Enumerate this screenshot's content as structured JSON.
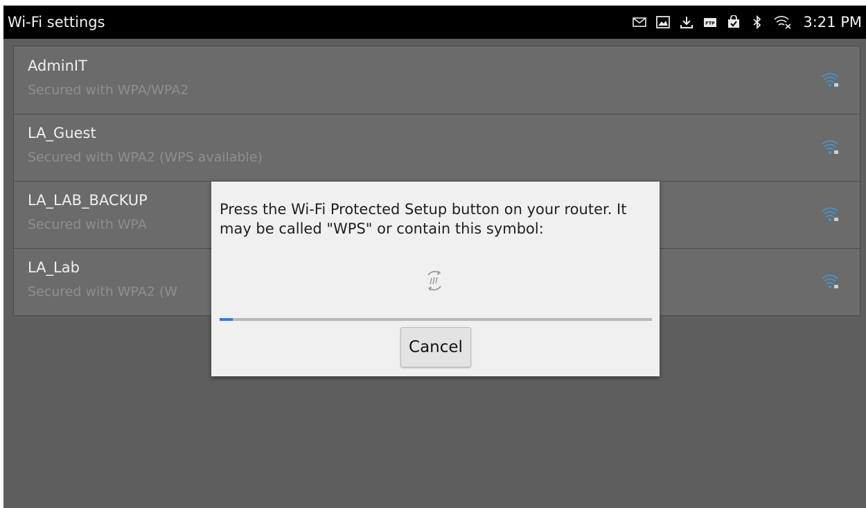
{
  "statusbar": {
    "title": "Wi-Fi settings",
    "time": "3:21 PM",
    "icons": [
      "mail-icon",
      "image-icon",
      "download-icon",
      "ftp-icon",
      "bag-check-icon",
      "bluetooth-icon",
      "wifi-x-icon"
    ]
  },
  "networks": [
    {
      "ssid": "AdminIT",
      "security": "Secured with WPA/WPA2"
    },
    {
      "ssid": "LA_Guest",
      "security": "Secured with WPA2 (WPS available)"
    },
    {
      "ssid": "LA_LAB_BACKUP",
      "security": "Secured with WPA"
    },
    {
      "ssid": "LA_Lab",
      "security": "Secured with WPA2 (W"
    }
  ],
  "dialog": {
    "message": "Press the Wi-Fi Protected Setup button on your router. It may be called \"WPS\" or contain this symbol:",
    "progress_percent": 3,
    "cancel_label": "Cancel"
  },
  "colors": {
    "accent": "#2f7fd6",
    "wifi_icon": "#4a90c8"
  }
}
